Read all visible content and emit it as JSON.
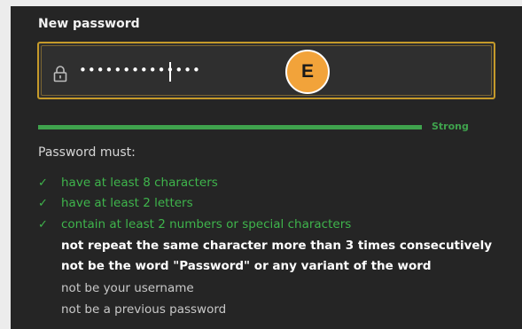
{
  "form": {
    "field_label": "New password",
    "password_mask": "••••••••••••••",
    "badge_letter": "E",
    "strength_label": "Strong",
    "strength_fraction": 1.0,
    "rules_heading": "Password must:",
    "rules": [
      {
        "text": "have at least 8 characters",
        "met": true
      },
      {
        "text": "have at least 2 letters",
        "met": true
      },
      {
        "text": "contain at least 2 numbers or special characters",
        "met": true
      },
      {
        "text": "not repeat the same character more than 3 times consecutively",
        "met": false
      },
      {
        "text": "not be the word \"Password\" or any variant of the word",
        "met": false
      },
      {
        "text": "not be your username",
        "met": false
      },
      {
        "text": "not be a previous password",
        "met": false
      }
    ]
  },
  "colors": {
    "panel_bg": "#252525",
    "focus_border": "#c59a2a",
    "success": "#3fa34d",
    "badge": "#f2a33a"
  },
  "icons": {
    "lock": "lock-icon",
    "check": "check-icon"
  }
}
